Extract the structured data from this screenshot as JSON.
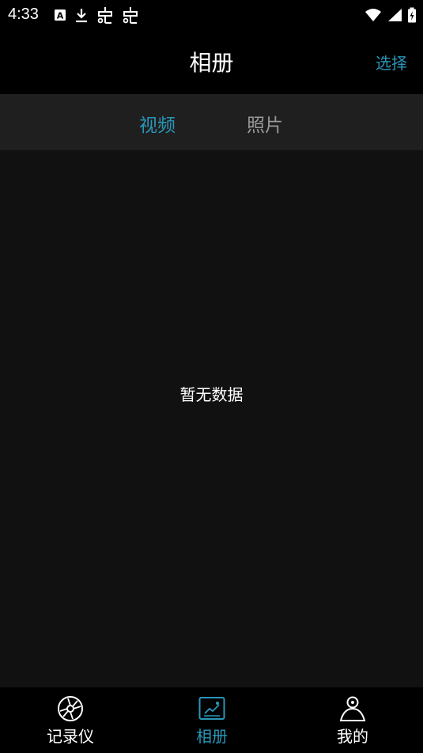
{
  "status_bar": {
    "time": "4:33",
    "left_icons": [
      "accessibility-a-icon",
      "download-icon",
      "bug-icon",
      "bug-icon"
    ],
    "right_icons": [
      "wifi-icon",
      "cellular-signal-icon",
      "battery-charging-icon"
    ]
  },
  "header": {
    "title": "相册",
    "select_label": "选择"
  },
  "tabs": [
    {
      "label": "视频",
      "active": true
    },
    {
      "label": "照片",
      "active": false
    }
  ],
  "content": {
    "empty_text": "暂无数据"
  },
  "bottom_nav": {
    "items": [
      {
        "label": "记录仪",
        "icon": "camera-aperture-icon",
        "active": false
      },
      {
        "label": "相册",
        "icon": "album-image-icon",
        "active": true
      },
      {
        "label": "我的",
        "icon": "person-icon",
        "active": false
      }
    ]
  },
  "colors": {
    "accent": "#2a96b8",
    "inactive_tab": "#9a9a9a",
    "tab_bar_bg": "#1f1f1f",
    "content_bg": "#111111",
    "bar_bg": "#000000"
  }
}
